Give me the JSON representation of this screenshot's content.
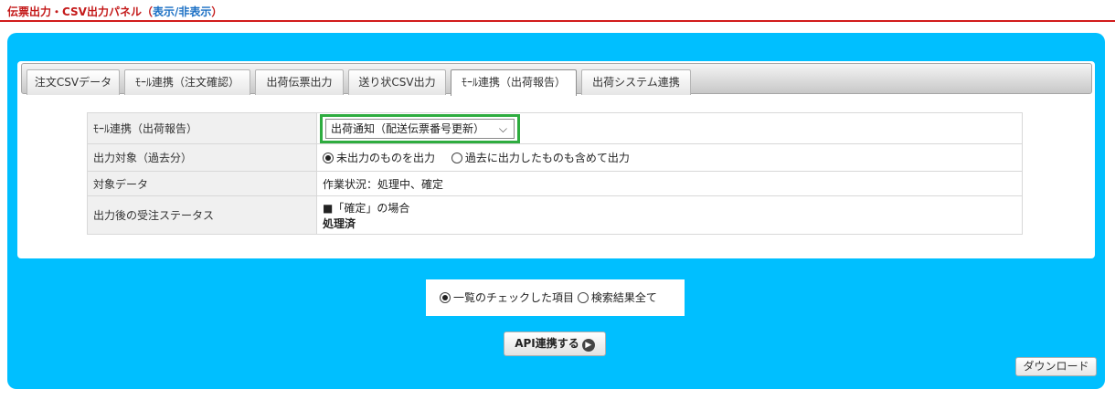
{
  "header": {
    "title": "伝票出力・CSV出力パネル（",
    "toggle_label": "表示/非表示",
    "close_paren": "）"
  },
  "tabs": [
    {
      "label": "注文CSVデータ",
      "active": false
    },
    {
      "label": "ﾓｰﾙ連携（注文確認）",
      "active": false
    },
    {
      "label": "出荷伝票出力",
      "active": false
    },
    {
      "label": "送り状CSV出力",
      "active": false
    },
    {
      "label": "ﾓｰﾙ連携（出荷報告）",
      "active": true
    },
    {
      "label": "出荷システム連携",
      "active": false
    }
  ],
  "settings": {
    "mall_label": "ﾓｰﾙ連携（出荷報告）",
    "mall_select_value": "出荷通知（配送伝票番号更新）",
    "output_target_label": "出力対象（過去分）",
    "output_target_options": [
      "未出力のものを出力",
      "過去に出力したものも含めて出力"
    ],
    "output_target_selected": 0,
    "target_data_label": "対象データ",
    "target_data_value": "作業状況：処理中、確定",
    "status_label": "出力後の受注ステータス",
    "status_line1": "■「確定」の場合",
    "status_line2": "処理済"
  },
  "scope": {
    "options": [
      "一覧のチェックした項目",
      "検索結果全て"
    ],
    "selected": 0
  },
  "buttons": {
    "api_label": "API連携する",
    "download_label": "ダウンロード"
  },
  "icons": {
    "select": "chevron-down-icon",
    "api": "arrow-right-circle-icon"
  },
  "colors": {
    "accent_blue": "#00bfff",
    "header_red": "#c41a1a",
    "highlight_green": "#2eac3f"
  }
}
